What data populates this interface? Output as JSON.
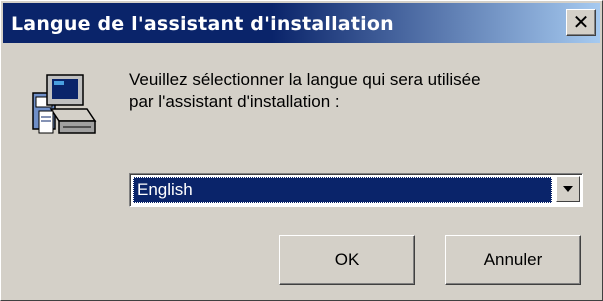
{
  "window": {
    "title": "Langue de l'assistant d'installation",
    "close_glyph": "✕"
  },
  "icon": {
    "name": "setup-computer-icon"
  },
  "message": {
    "line1": "Veuillez sélectionner la langue qui sera utilisée",
    "line2": "par l'assistant d'installation :"
  },
  "language_select": {
    "selected": "English"
  },
  "buttons": {
    "ok": "OK",
    "cancel": "Annuler"
  },
  "colors": {
    "title_bar": "#0a246a",
    "title_bar_end": "#a6caf0",
    "dialog_bg": "#d4d0c8",
    "selection": "#0a246a"
  }
}
